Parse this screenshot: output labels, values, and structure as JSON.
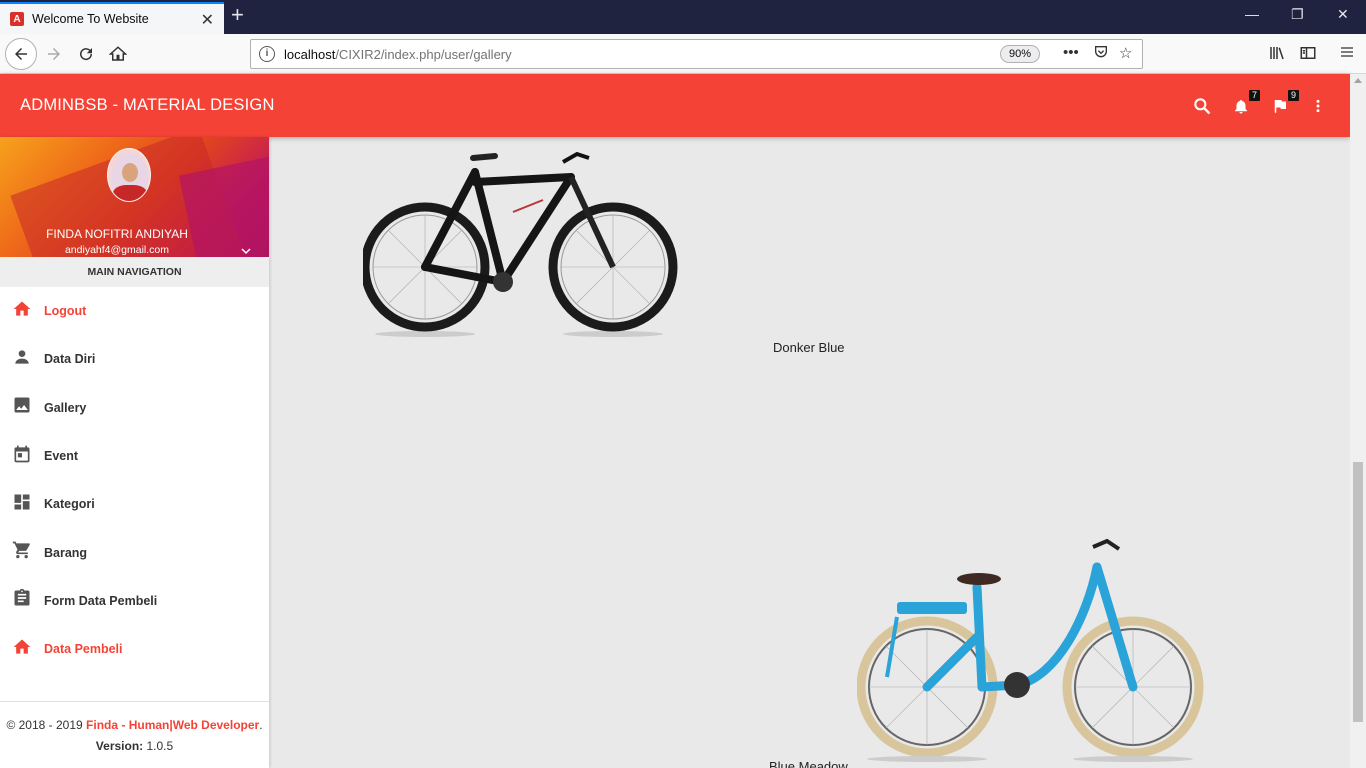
{
  "browser": {
    "tab_title": "Welcome To Website",
    "favicon_letter": "A",
    "url_host": "localhost",
    "url_path": "/CIXIR2/index.php/user/gallery",
    "zoom": "90%"
  },
  "header": {
    "brand": "ADMINBSB - MATERIAL DESIGN",
    "notifications_count": "7",
    "tasks_count": "9",
    "accent_color": "#f44336"
  },
  "user": {
    "name": "FINDA NOFITRI ANDIYAH",
    "email": "andiyahf4@gmail.com"
  },
  "sidebar": {
    "nav_header": "MAIN NAVIGATION",
    "items": [
      {
        "label": "Logout",
        "icon": "home-icon"
      },
      {
        "label": "Data Diri",
        "icon": "person-icon"
      },
      {
        "label": "Gallery",
        "icon": "image-icon"
      },
      {
        "label": "Event",
        "icon": "calendar-icon"
      },
      {
        "label": "Kategori",
        "icon": "dashboard-icon"
      },
      {
        "label": "Barang",
        "icon": "cart-icon"
      },
      {
        "label": "Form Data Pembeli",
        "icon": "clipboard-icon"
      },
      {
        "label": "Data Pembeli",
        "icon": "home-icon"
      }
    ]
  },
  "footer": {
    "copyright": "© 2018 - 2019 ",
    "author": "Finda - Human|Web Developer",
    "period": ".",
    "version_label": "Version:",
    "version": " 1.0.5"
  },
  "gallery": {
    "items": [
      {
        "caption": "Donker Blue",
        "color": "#1a1a1a"
      },
      {
        "caption": "Blue Meadow",
        "color": "#2a9fd6"
      }
    ]
  }
}
